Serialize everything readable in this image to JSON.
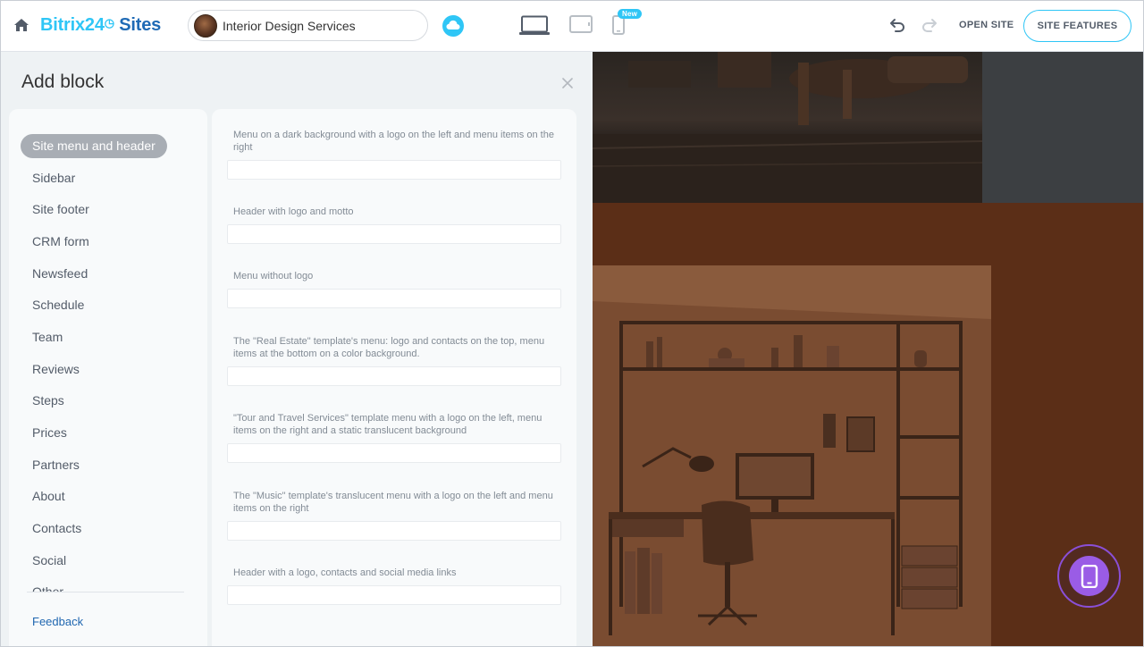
{
  "header": {
    "logo_b24": "Bitrix24",
    "logo_sites": "Sites",
    "site_name": "Interior Design Services",
    "new_badge": "New",
    "open_site": "OPEN SITE",
    "site_features": "SITE FEATURES"
  },
  "panel": {
    "title": "Add block",
    "categories": [
      {
        "label": "Site menu and header",
        "active": true
      },
      {
        "label": "Sidebar"
      },
      {
        "label": "Site footer"
      },
      {
        "label": "CRM form"
      },
      {
        "label": "Newsfeed"
      },
      {
        "label": "Schedule"
      },
      {
        "label": "Team"
      },
      {
        "label": "Reviews"
      },
      {
        "label": "Steps"
      },
      {
        "label": "Prices"
      },
      {
        "label": "Partners"
      },
      {
        "label": "About"
      },
      {
        "label": "Contacts"
      },
      {
        "label": "Social"
      },
      {
        "label": "Other"
      }
    ],
    "feedback": "Feedback",
    "blocks": [
      {
        "description": "Menu on a dark background with a logo on the left and menu items on the right"
      },
      {
        "description": "Header with logo and motto"
      },
      {
        "description": "Menu without logo"
      },
      {
        "description": "The \"Real Estate\" template's menu: logo and contacts on the top, menu items at the bottom on a color background."
      },
      {
        "description": "\"Tour and Travel Services\" template menu with a logo on the left, menu items on the right and a static translucent background"
      },
      {
        "description": "The \"Music\" template's translucent menu with a logo on the left and menu items on the right"
      },
      {
        "description": "Header with a logo, contacts and social media links"
      }
    ]
  },
  "colors": {
    "accent": "#2fc6f6",
    "brand_dark": "#1f6ab5",
    "active_category": "#a8adb4",
    "fab": "#9a5ce6"
  },
  "icons": [
    "home-icon",
    "cloud-icon",
    "desktop-icon",
    "tablet-icon",
    "mobile-icon",
    "undo-icon",
    "redo-icon",
    "close-icon",
    "phone-icon"
  ]
}
